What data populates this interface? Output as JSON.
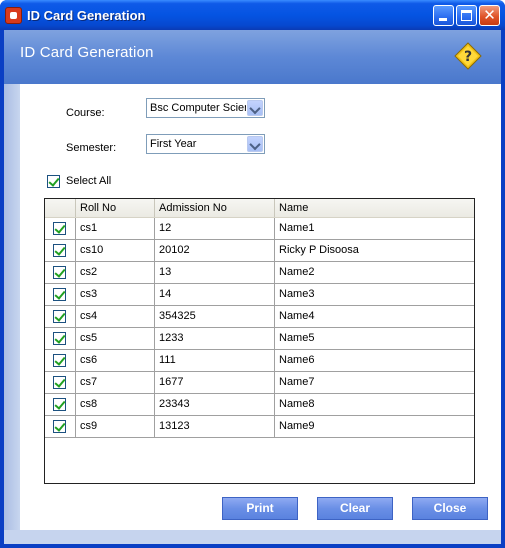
{
  "window": {
    "title": "ID Card Generation"
  },
  "header": {
    "title": "ID Card Generation"
  },
  "form": {
    "course_label": "Course:",
    "course_value": "Bsc Computer Scier",
    "semester_label": "Semester:",
    "semester_value": "First Year",
    "select_all_label": "Select All",
    "select_all_checked": true
  },
  "grid": {
    "columns": [
      "",
      "Roll No",
      "Admission No",
      "Name"
    ],
    "rows": [
      {
        "checked": true,
        "roll": "cs1",
        "admission": "12",
        "name": "Name1"
      },
      {
        "checked": true,
        "roll": "cs10",
        "admission": "20102",
        "name": "Ricky P Disoosa"
      },
      {
        "checked": true,
        "roll": "cs2",
        "admission": "13",
        "name": "Name2"
      },
      {
        "checked": true,
        "roll": "cs3",
        "admission": "14",
        "name": "Name3"
      },
      {
        "checked": true,
        "roll": "cs4",
        "admission": "354325",
        "name": "Name4"
      },
      {
        "checked": true,
        "roll": "cs5",
        "admission": "1233",
        "name": "Name5"
      },
      {
        "checked": true,
        "roll": "cs6",
        "admission": "111",
        "name": "Name6"
      },
      {
        "checked": true,
        "roll": "cs7",
        "admission": "1677",
        "name": "Name7"
      },
      {
        "checked": true,
        "roll": "cs8",
        "admission": "23343",
        "name": "Name8"
      },
      {
        "checked": true,
        "roll": "cs9",
        "admission": "13123",
        "name": "Name9"
      }
    ]
  },
  "buttons": {
    "print": "Print",
    "clear": "Clear",
    "close": "Close"
  },
  "icons": {
    "app": "id-card-app-icon",
    "help": "help-icon"
  },
  "colors": {
    "titlebar": "#0554e2",
    "header": "#5d88d6",
    "check": "#21a121",
    "button": "#6a8fe6"
  }
}
